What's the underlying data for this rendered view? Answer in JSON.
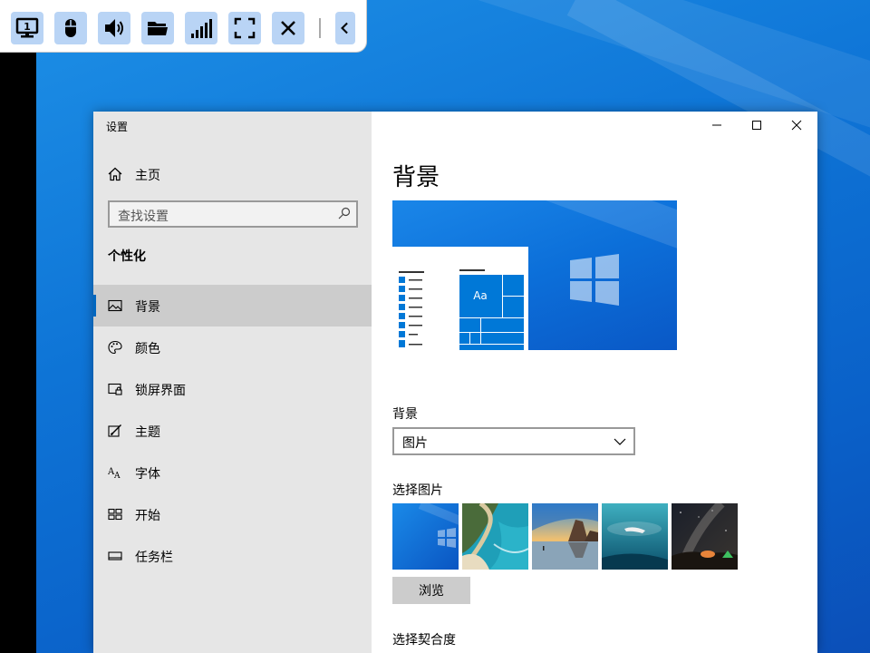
{
  "toolbar": {
    "buttons": [
      {
        "icon": "monitor-1-icon"
      },
      {
        "icon": "mouse-icon"
      },
      {
        "icon": "speaker-icon"
      },
      {
        "icon": "folder-icon"
      },
      {
        "icon": "signal-icon"
      },
      {
        "icon": "fullscreen-icon"
      },
      {
        "icon": "close-icon"
      },
      {
        "icon": "chevron-left-icon"
      }
    ],
    "monitor_number": "1"
  },
  "window": {
    "title": "设置",
    "caption": {
      "minimize": "minimize-icon",
      "maximize": "maximize-icon",
      "close": "close-icon"
    }
  },
  "sidebar": {
    "home_label": "主页",
    "search_placeholder": "查找设置",
    "section_title": "个性化",
    "items": [
      {
        "label": "背景",
        "icon": "picture-icon",
        "active": true
      },
      {
        "label": "颜色",
        "icon": "palette-icon",
        "active": false
      },
      {
        "label": "锁屏界面",
        "icon": "lock-screen-icon",
        "active": false
      },
      {
        "label": "主题",
        "icon": "theme-icon",
        "active": false
      },
      {
        "label": "字体",
        "icon": "font-icon",
        "active": false
      },
      {
        "label": "开始",
        "icon": "start-icon",
        "active": false
      },
      {
        "label": "任务栏",
        "icon": "taskbar-icon",
        "active": false
      }
    ]
  },
  "main": {
    "title": "背景",
    "preview": {
      "tile_label": "Aa"
    },
    "background_label": "背景",
    "background_value": "图片",
    "choose_picture_label": "选择图片",
    "browse_label": "浏览",
    "fit_label": "选择契合度"
  },
  "colors": {
    "accent": "#0067c0",
    "sidebar": "#e6e6e6",
    "tile_blue": "#0078d7"
  }
}
